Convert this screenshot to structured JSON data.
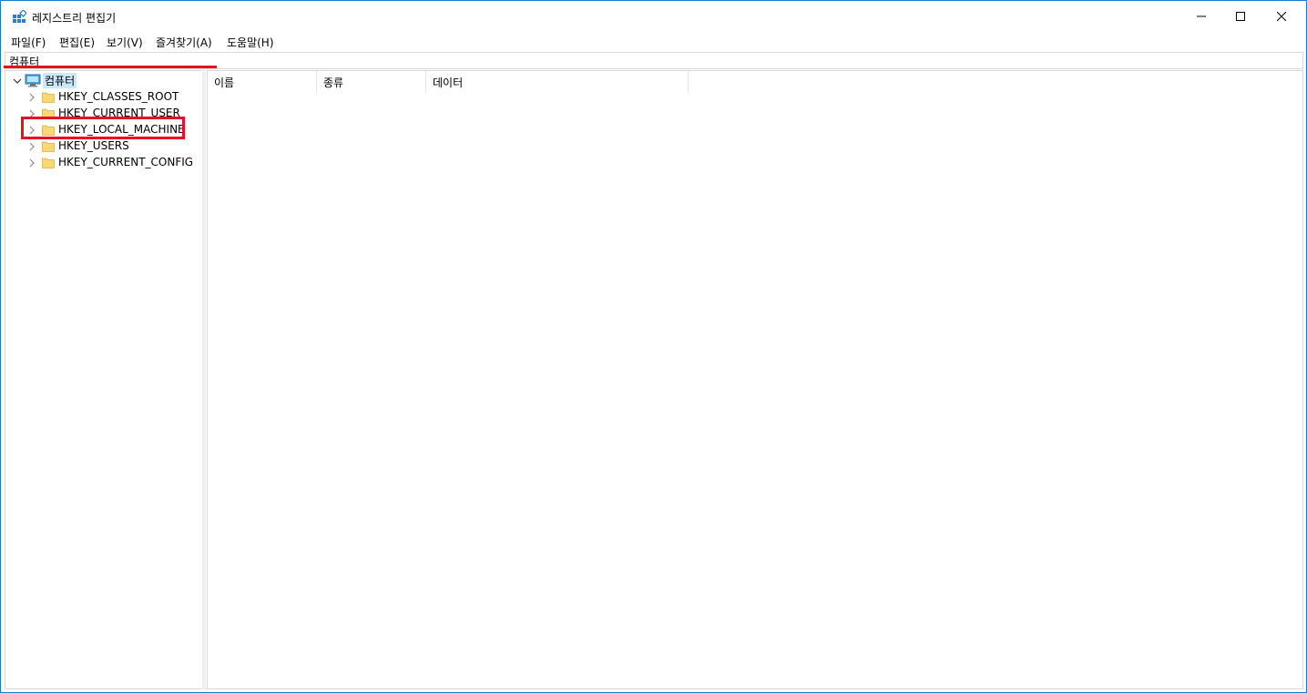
{
  "window": {
    "title": "레지스트리 편집기"
  },
  "menubar": {
    "items": [
      "파일(F)",
      "편집(E)",
      "보기(V)",
      "즐겨찾기(A)",
      "도움말(H)"
    ]
  },
  "address": {
    "path": "컴퓨터"
  },
  "tree": {
    "root": "컴퓨터",
    "children": [
      "HKEY_CLASSES_ROOT",
      "HKEY_CURRENT_USER",
      "HKEY_LOCAL_MACHINE",
      "HKEY_USERS",
      "HKEY_CURRENT_CONFIG"
    ]
  },
  "list": {
    "columns": [
      "이름",
      "종류",
      "데이터"
    ]
  },
  "colors": {
    "highlight": "#e81123",
    "accent": "#1a6fd0",
    "selection": "#cce8ff"
  }
}
